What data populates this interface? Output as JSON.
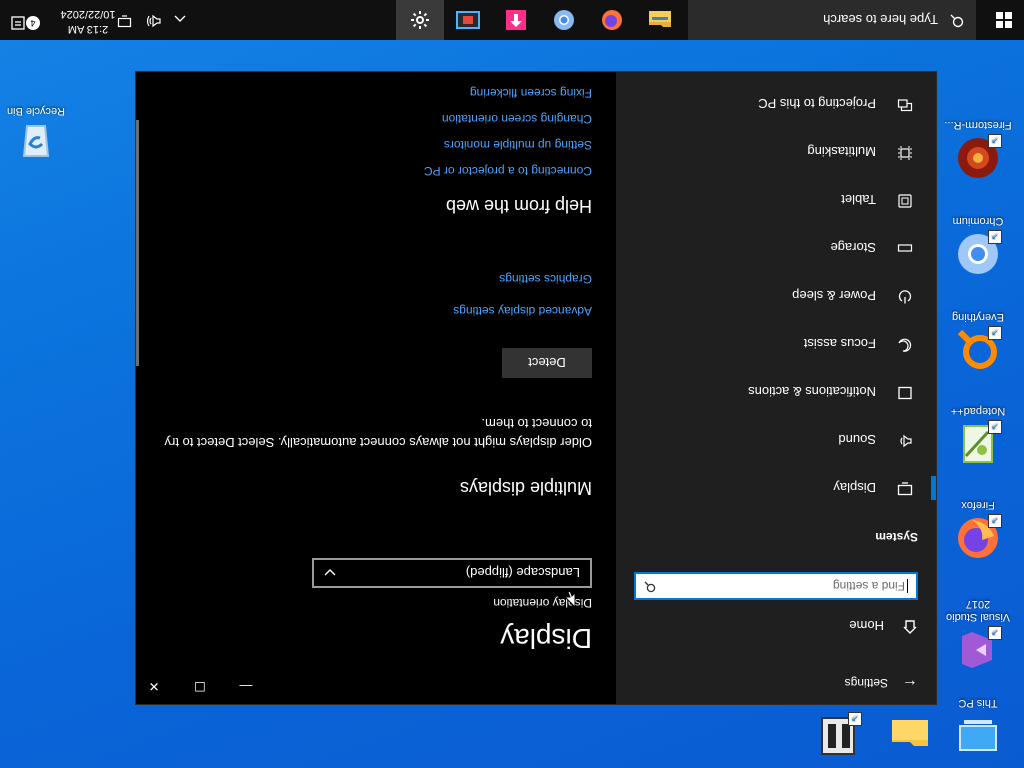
{
  "desktop": {
    "icons_left": [
      {
        "label": "This PC",
        "icon": "this-pc-icon"
      },
      {
        "label": "Visual Studio 2017",
        "icon": "visual-studio-icon"
      },
      {
        "label": "Firefox",
        "icon": "firefox-icon"
      },
      {
        "label": "Notepad++",
        "icon": "notepadpp-icon"
      },
      {
        "label": "Everything",
        "icon": "everything-icon"
      },
      {
        "label": "Chromium",
        "icon": "chromium-icon"
      },
      {
        "label": "Firestorm-R...",
        "icon": "firestorm-icon"
      }
    ],
    "icons_bottom": [
      {
        "label": "",
        "icon": "folder-icon"
      },
      {
        "label": "",
        "icon": "total-commander-icon"
      }
    ],
    "recycle_bin": {
      "label": "Recycle Bin",
      "icon": "recycle-bin-icon"
    }
  },
  "settings": {
    "window_title": "Settings",
    "nav": {
      "home_label": "Home",
      "search_placeholder": "Find a setting",
      "section_title": "System",
      "items": [
        {
          "label": "Display",
          "icon": "monitor-icon",
          "active": true
        },
        {
          "label": "Sound",
          "icon": "speaker-icon",
          "active": false
        },
        {
          "label": "Notifications & actions",
          "icon": "notification-icon",
          "active": false
        },
        {
          "label": "Focus assist",
          "icon": "moon-icon",
          "active": false
        },
        {
          "label": "Power & sleep",
          "icon": "power-icon",
          "active": false
        },
        {
          "label": "Storage",
          "icon": "storage-icon",
          "active": false
        },
        {
          "label": "Tablet",
          "icon": "tablet-icon",
          "active": false
        },
        {
          "label": "Multitasking",
          "icon": "multitasking-icon",
          "active": false
        },
        {
          "label": "Projecting to this PC",
          "icon": "projecting-icon",
          "active": false
        }
      ]
    },
    "content": {
      "title": "Display",
      "orientation_label": "Display orientation",
      "orientation_value": "Landscape (flipped)",
      "multiple_displays_heading": "Multiple displays",
      "multiple_displays_text": "Older displays might not always connect automatically. Select Detect to try to connect to them.",
      "detect_label": "Detect",
      "advanced_link": "Advanced display settings",
      "graphics_link": "Graphics settings",
      "help_heading": "Help from the web",
      "help_links": [
        "Connecting to a projector or PC",
        "Setting up multiple monitors",
        "Changing screen orientation",
        "Fixing screen flickering"
      ]
    },
    "window_controls": {
      "minimize": "—",
      "maximize": "☐",
      "close": "✕"
    }
  },
  "taskbar": {
    "search_placeholder": "Type here to search",
    "apps": [
      {
        "name": "file-explorer",
        "icon": "folder-icon"
      },
      {
        "name": "firefox",
        "icon": "firefox-icon"
      },
      {
        "name": "chromium",
        "icon": "chromium-icon"
      },
      {
        "name": "app-pink",
        "icon": "pink-app-icon"
      },
      {
        "name": "media",
        "icon": "film-icon"
      },
      {
        "name": "settings",
        "icon": "gear-icon",
        "active": true
      }
    ],
    "tray": {
      "time": "2:13 AM",
      "date": "10/22/2024",
      "notification_count": "4"
    }
  },
  "colors": {
    "accent": "#0078d7",
    "link": "#4aa3ff",
    "desktop": "#0a66d8",
    "nav_bg": "#1f1f1f",
    "taskbar_bg": "#101010"
  }
}
